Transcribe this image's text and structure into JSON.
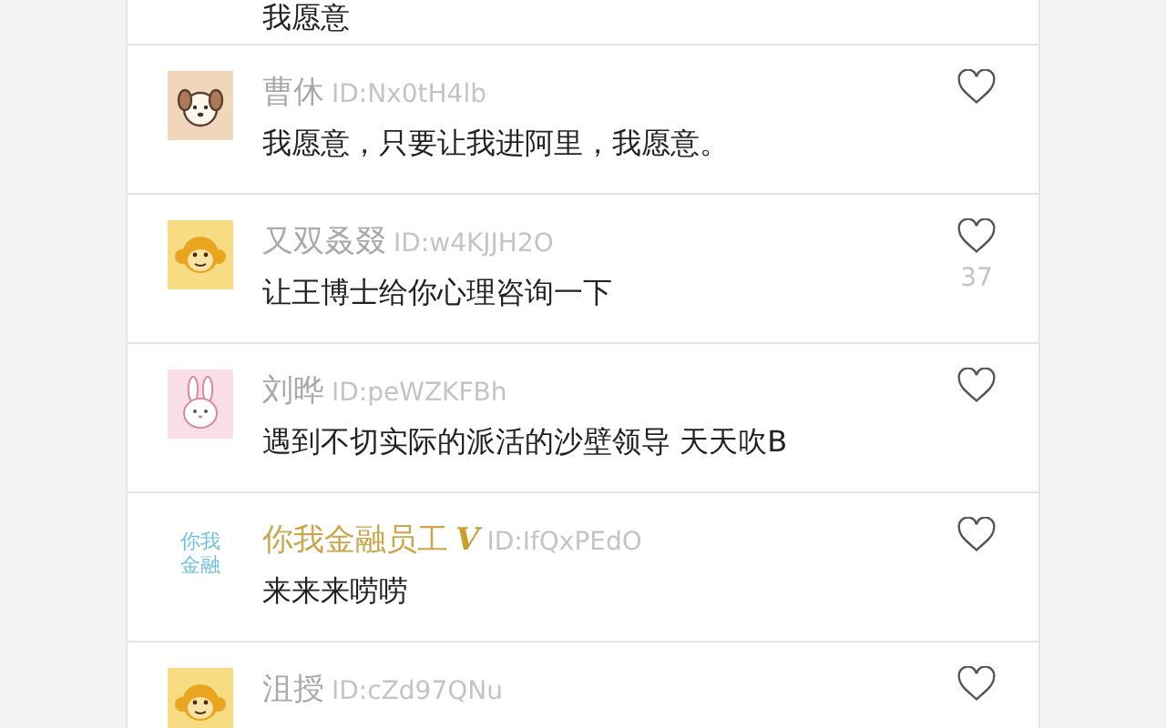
{
  "top_comment": {
    "text": "我愿意"
  },
  "comments": [
    {
      "avatar": {
        "kind": "dog"
      },
      "name": "曹休",
      "verified": false,
      "user_id": "ID:Nx0tH4lb",
      "text": "我愿意，只要让我进阿里，我愿意。"
    },
    {
      "avatar": {
        "kind": "monkey"
      },
      "name": "又双叒叕",
      "verified": false,
      "user_id": "ID:w4KJJH2O",
      "text": "让王博士给你心理咨询一下",
      "likes": "37"
    },
    {
      "avatar": {
        "kind": "rabbit"
      },
      "name": "刘晔",
      "verified": false,
      "user_id": "ID:peWZKFBh",
      "text": "遇到不切实际的派活的沙壁领导 天天吹B"
    },
    {
      "avatar": {
        "kind": "text",
        "lines": [
          "你我",
          "金融"
        ]
      },
      "name": "你我金融员工",
      "verified": true,
      "badge": "V",
      "user_id": "ID:IfQxPEdO",
      "text": "来来来唠唠"
    },
    {
      "avatar": {
        "kind": "monkey"
      },
      "name": "沮授",
      "verified": false,
      "user_id": "ID:cZd97QNu"
    }
  ]
}
